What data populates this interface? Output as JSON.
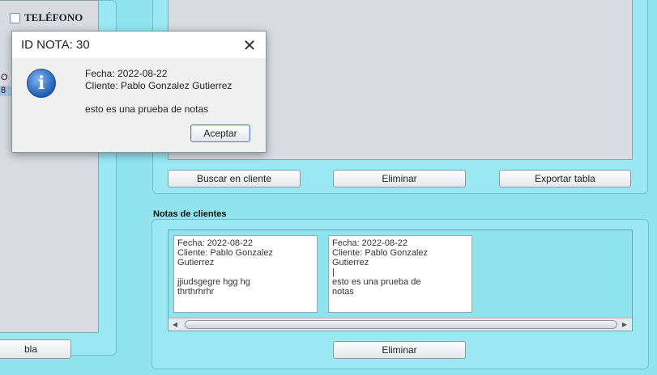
{
  "left": {
    "checkbox_label": "TELÉFONO",
    "rows": [
      "O",
      "8"
    ],
    "bottom_button": "bla"
  },
  "actions": {
    "search_client": "Buscar en cliente",
    "delete": "Eliminar",
    "export_table": "Exportar tabla"
  },
  "notes": {
    "section_title": "Notas de clientes",
    "cards": [
      {
        "text": "Fecha: 2022-08-22\nCliente: Pablo Gonzalez\nGutierrez\n\njjiudsgegre hgg hg\nthrthrhrhr"
      },
      {
        "text": "Fecha: 2022-08-22\nCliente: Pablo Gonzalez\nGutierrez\n|\nesto es una prueba de\nnotas"
      }
    ],
    "delete_button": "Eliminar"
  },
  "dialog": {
    "title": "ID NOTA: 30",
    "close_glyph": "✕",
    "icon_glyph": "i",
    "date_line": "Fecha: 2022-08-22",
    "client_line": "Cliente: Pablo Gonzalez Gutierrez",
    "message": "esto es una prueba de notas",
    "ok_button": "Aceptar"
  },
  "scrollbar": {
    "left_arrow": "◀",
    "right_arrow": "▶"
  }
}
